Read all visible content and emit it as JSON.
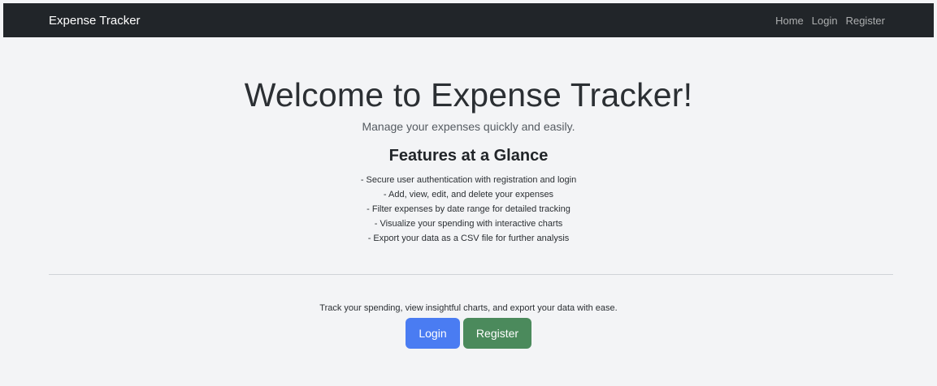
{
  "navbar": {
    "brand": "Expense Tracker",
    "links": [
      "Home",
      "Login",
      "Register"
    ]
  },
  "hero": {
    "title": "Welcome to Expense Tracker!",
    "subtitle": "Manage your expenses quickly and easily."
  },
  "features": {
    "heading": "Features at a Glance",
    "items": [
      "- Secure user authentication with registration and login",
      "- Add, view, edit, and delete your expenses",
      "- Filter expenses by date range for detailed tracking",
      "- Visualize your spending with interactive charts",
      "- Export your data as a CSV file for further analysis"
    ]
  },
  "cta": {
    "tagline": "Track your spending, view insightful charts, and export your data with ease.",
    "login_label": "Login",
    "register_label": "Register"
  },
  "colors": {
    "navbar_bg": "#212529",
    "page_bg": "#f3f4f6",
    "login_button": "#4a7cf2",
    "register_button": "#4b8a5c"
  }
}
